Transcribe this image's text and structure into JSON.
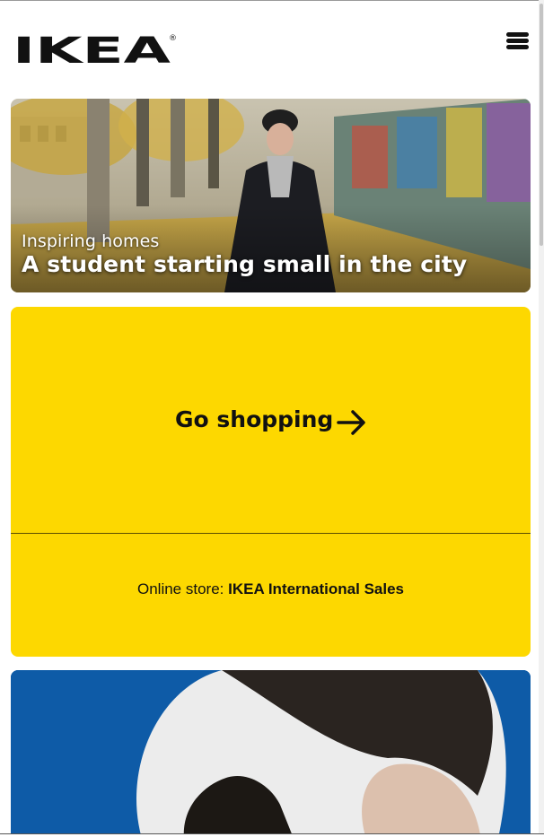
{
  "header": {
    "logo_text": "IKEA",
    "logo_registered_mark": "®",
    "menu_icon": "hamburger-menu-icon"
  },
  "hero": {
    "kicker": "Inspiring homes",
    "title": "A student starting small in the city"
  },
  "shopping_card": {
    "cta_label": "Go shopping",
    "cta_icon": "arrow-right-icon",
    "store_prefix": "Online store:",
    "store_name": "IKEA International Sales",
    "background_color": "#fdd800"
  },
  "promo_card": {
    "background_color": "#0e5ba7"
  },
  "colors": {
    "brand_yellow": "#fdd800",
    "brand_blue": "#0e5ba7",
    "text": "#111111"
  }
}
